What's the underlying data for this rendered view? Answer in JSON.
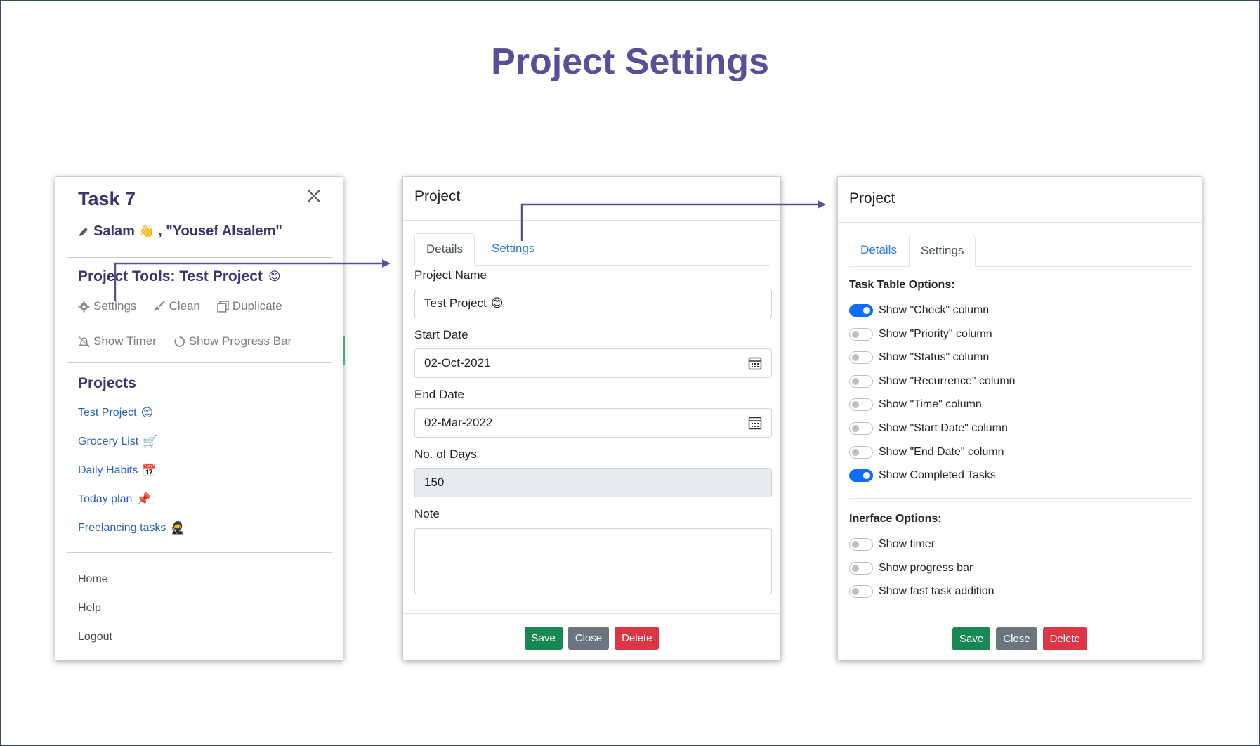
{
  "page": {
    "title": "Project Settings"
  },
  "colors": {
    "accent_title": "#5b4e96",
    "link": "#2a7bd4",
    "save": "#198754",
    "close": "#6c757d",
    "delete": "#dc3545",
    "toggle_on": "#0d6efd"
  },
  "sidebar": {
    "title": "Task 7",
    "greeting": "Salam",
    "greeting_emoji": "👋",
    "user_name": ", \"Yousef Alsalem\"",
    "tools_title": "Project Tools: Test Project",
    "tools_emoji": "😊",
    "tools": {
      "settings": "Settings",
      "clean": "Clean",
      "duplicate": "Duplicate"
    },
    "toggles": {
      "show_timer": "Show Timer",
      "show_progress_bar": "Show Progress Bar"
    },
    "projects_title": "Projects",
    "projects": [
      {
        "name": "Test Project",
        "emoji": "😊"
      },
      {
        "name": "Grocery List",
        "emoji": "🛒"
      },
      {
        "name": "Daily Habits",
        "emoji": "📅"
      },
      {
        "name": "Today plan",
        "emoji": "📌"
      },
      {
        "name": "Freelancing tasks",
        "emoji": "🥷"
      }
    ],
    "nav": {
      "home": "Home",
      "help": "Help",
      "logout": "Logout"
    }
  },
  "details_modal": {
    "title": "Project",
    "tabs": {
      "details": "Details",
      "settings": "Settings"
    },
    "fields": {
      "project_name_label": "Project Name",
      "project_name_value": "Test Project",
      "project_name_emoji": "😊",
      "start_date_label": "Start Date",
      "start_date_value": "02-Oct-2021",
      "end_date_label": "End Date",
      "end_date_value": "02-Mar-2022",
      "days_label": "No. of Days",
      "days_value": "150",
      "note_label": "Note"
    },
    "buttons": {
      "save": "Save",
      "close": "Close",
      "delete": "Delete"
    }
  },
  "settings_modal": {
    "title": "Project",
    "tabs": {
      "details": "Details",
      "settings": "Settings"
    },
    "task_table_title": "Task Table Options:",
    "task_table_options": [
      {
        "label": "Show \"Check\" column",
        "on": true
      },
      {
        "label": "Show \"Priority\" column",
        "on": false
      },
      {
        "label": "Show \"Status\" column",
        "on": false
      },
      {
        "label": "Show \"Recurrence\" column",
        "on": false
      },
      {
        "label": "Show \"Time\" column",
        "on": false
      },
      {
        "label": "Show \"Start Date\" column",
        "on": false
      },
      {
        "label": "Show \"End Date\" column",
        "on": false
      },
      {
        "label": "Show Completed Tasks",
        "on": true
      }
    ],
    "interface_title": "Inerface Options:",
    "interface_options": [
      {
        "label": "Show timer",
        "on": false
      },
      {
        "label": "Show progress bar",
        "on": false
      },
      {
        "label": "Show fast task addition",
        "on": false
      }
    ],
    "buttons": {
      "save": "Save",
      "close": "Close",
      "delete": "Delete"
    }
  }
}
